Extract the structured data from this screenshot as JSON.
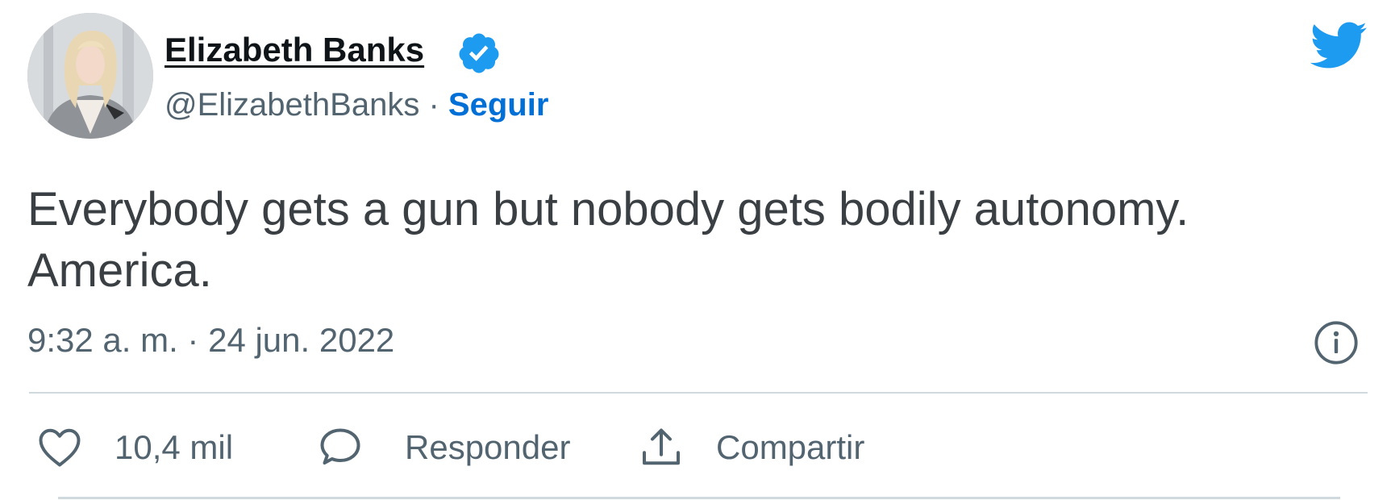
{
  "author": {
    "name": "Elizabeth Banks",
    "handle": "@ElizabethBanks",
    "separator": "·",
    "follow_label": "Seguir"
  },
  "tweet": {
    "line1": "Everybody gets a gun but nobody gets bodily autonomy.",
    "line2": "America.",
    "timestamp": "9:32 a. m. · 24 jun. 2022"
  },
  "actions": {
    "likes": "10,4 mil",
    "reply_label": "Responder",
    "share_label": "Compartir"
  },
  "icons": {
    "brand": "twitter-bird-icon",
    "verified": "verified-badge-icon",
    "info": "info-icon",
    "like": "heart-icon",
    "reply": "comment-icon",
    "share": "share-icon"
  },
  "colors": {
    "accent": "#1d9bf0",
    "follow": "#006fd6",
    "muted": "#536471",
    "divider": "#cfd9de"
  }
}
